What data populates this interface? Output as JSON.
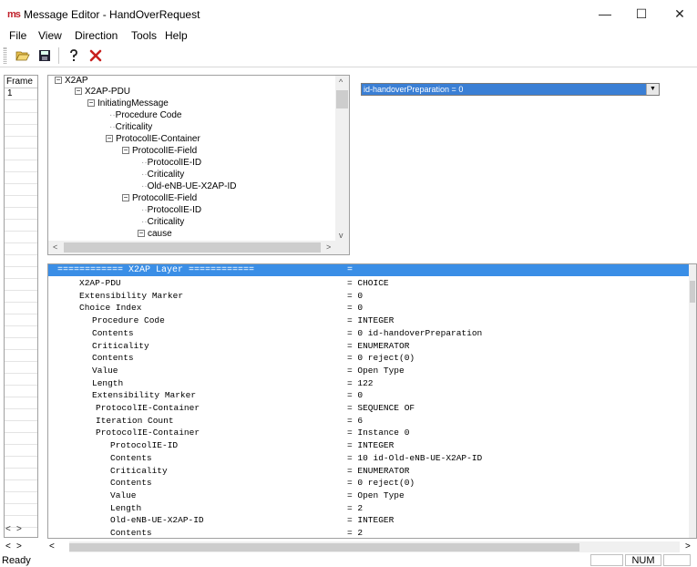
{
  "window": {
    "icon_text": "ms",
    "title": "Message Editor - HandOverRequest",
    "minimize": "—",
    "maximize": "☐",
    "close": "✕"
  },
  "menu": [
    "File",
    "View",
    "Direction",
    "Tools",
    "Help"
  ],
  "toolbar": {
    "open_icon": "folder-open-icon",
    "save_icon": "save-icon",
    "help_icon": "help-icon",
    "delete_icon": "delete-x-icon",
    "accent_delete": "#c8201e"
  },
  "frame_panel": {
    "header": "Frame",
    "rows": [
      "1"
    ]
  },
  "tree": {
    "nodes": [
      {
        "label": "X2AP",
        "expander": "−"
      },
      {
        "label": "X2AP-PDU",
        "expander": "−"
      },
      {
        "label": "InitiatingMessage",
        "expander": "−"
      },
      {
        "label": "Procedure Code",
        "expander": ""
      },
      {
        "label": "Criticality",
        "expander": ""
      },
      {
        "label": "ProtocolIE-Container",
        "expander": "−"
      },
      {
        "label": "ProtocolIE-Field",
        "expander": "−"
      },
      {
        "label": "ProtocolIE-ID",
        "expander": ""
      },
      {
        "label": "Criticality",
        "expander": ""
      },
      {
        "label": "Old-eNB-UE-X2AP-ID",
        "expander": ""
      },
      {
        "label": "ProtocolIE-Field",
        "expander": "−"
      },
      {
        "label": "ProtocolIE-ID",
        "expander": ""
      },
      {
        "label": "Criticality",
        "expander": ""
      },
      {
        "label": "cause",
        "expander": "−"
      }
    ]
  },
  "dropdown": {
    "selected": "id-handoverPreparation = 0"
  },
  "details": {
    "header_name": "============ X2AP Layer ============",
    "header_value": "=",
    "rows": [
      {
        "name": "X2AP-PDU",
        "value": "= CHOICE"
      },
      {
        "name": "Extensibility Marker",
        "value": "= 0"
      },
      {
        "name": "Choice Index",
        "value": "= 0"
      },
      {
        "name": "Procedure Code",
        "value": "= INTEGER"
      },
      {
        "name": "Contents",
        "value": "= 0 id-handoverPreparation"
      },
      {
        "name": "Criticality",
        "value": "= ENUMERATOR"
      },
      {
        "name": "Contents",
        "value": "= 0  reject(0)"
      },
      {
        "name": "Value",
        "value": "= Open Type"
      },
      {
        "name": "Length",
        "value": "= 122"
      },
      {
        "name": "Extensibility Marker",
        "value": "= 0"
      },
      {
        "name": "ProtocolIE-Container",
        "value": "= SEQUENCE OF"
      },
      {
        "name": "Iteration Count",
        "value": "= 6"
      },
      {
        "name": "ProtocolIE-Container",
        "value": "= Instance 0"
      },
      {
        "name": "ProtocolIE-ID",
        "value": "= INTEGER"
      },
      {
        "name": "Contents",
        "value": "= 10 id-Old-eNB-UE-X2AP-ID"
      },
      {
        "name": "Criticality",
        "value": "= ENUMERATOR"
      },
      {
        "name": "Contents",
        "value": "= 0  reject(0)"
      },
      {
        "name": "Value",
        "value": "= Open Type"
      },
      {
        "name": "Length",
        "value": "= 2"
      },
      {
        "name": "Old-eNB-UE-X2AP-ID",
        "value": "= INTEGER"
      },
      {
        "name": "Contents",
        "value": "= 2"
      }
    ]
  },
  "status": {
    "text": "Ready",
    "num": "NUM"
  },
  "colors": {
    "selection": "#3a7fd5",
    "header": "#3a8ee6"
  }
}
